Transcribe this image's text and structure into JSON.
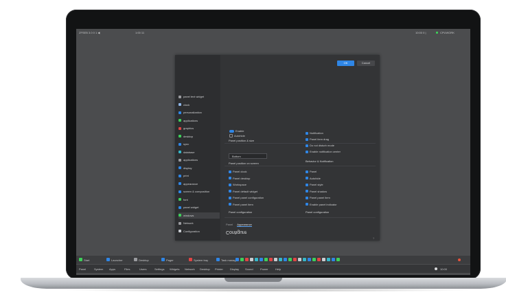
{
  "topbar": {
    "left_label": "ZFSEB 3.0 0 1 ◀",
    "center_label": "1:00 11",
    "right_label": "10:00 0 |",
    "right_status": "CPUWORK"
  },
  "dialog": {
    "ok_label": "OK",
    "cancel_label": "Cancel",
    "title": "Configure",
    "tabs": [
      "Panel",
      "Appearance"
    ],
    "sidebar": [
      {
        "label": "panel text widget",
        "color": "#9a9b9f"
      },
      {
        "label": "clock",
        "color": "#8fb6e8"
      },
      {
        "label": "personalization",
        "color": "#2f86e6"
      },
      {
        "label": "applications",
        "color": "#3ecf5a"
      },
      {
        "label": "graphics",
        "color": "#e04545"
      },
      {
        "label": "desktop",
        "color": "#3ecf5a"
      },
      {
        "label": "sync",
        "color": "#2f86e6"
      },
      {
        "label": "database",
        "color": "#35b7c9"
      },
      {
        "label": "applications",
        "color": "#9a9b9f"
      },
      {
        "label": "display",
        "color": "#2f86e6"
      },
      {
        "label": "print",
        "color": "#2f86e6"
      },
      {
        "label": "appearance",
        "color": "#2f86e6"
      },
      {
        "label": "screen & composition",
        "color": "#2f86e6"
      },
      {
        "label": "font",
        "color": "#3ecf5a"
      },
      {
        "label": "panel widget",
        "color": "#2f86e6"
      },
      {
        "label": "windows",
        "color": "#3ecf5a"
      },
      {
        "label": "Network",
        "color": "#9a9b9f"
      },
      {
        "label": "Configuration",
        "color": "#c9ccd1"
      }
    ],
    "general": {
      "heading": "Panel configuration",
      "left_options": [
        "Panel clock",
        "Panel desktop",
        "Workspace",
        "Panel default widget",
        "Panel panel configuration",
        "Panel panel item"
      ],
      "right_heading": "Panel configuration",
      "right_options": [
        "Panel",
        "Autohide",
        "Panel style",
        "Panel shadow",
        "Panel panel item",
        "Enable panel indicator"
      ]
    },
    "position": {
      "select_value": "Bottom",
      "label": "Panel position on screen",
      "heading": "Panel position & size",
      "right_heading": "Behavior & Notification",
      "right_options": [
        "Notification",
        "Panel item drag",
        "Do not disturb mode",
        "Enable notification center"
      ]
    },
    "toggle_labels": [
      "Enable",
      "Autohide"
    ],
    "help_label": "?"
  },
  "taskbar": {
    "top_items": [
      "Start",
      "Launcher",
      "Desktop",
      "Pager",
      "System tray",
      "Task manager"
    ],
    "bottom_items": [
      "Panel",
      "System",
      "Apps",
      "Files",
      "Users",
      "Settings",
      "Widgets",
      "Network",
      "Desktop",
      "Printer",
      "Display",
      "Sound",
      "Power",
      "Help"
    ],
    "clock": "10:00"
  }
}
